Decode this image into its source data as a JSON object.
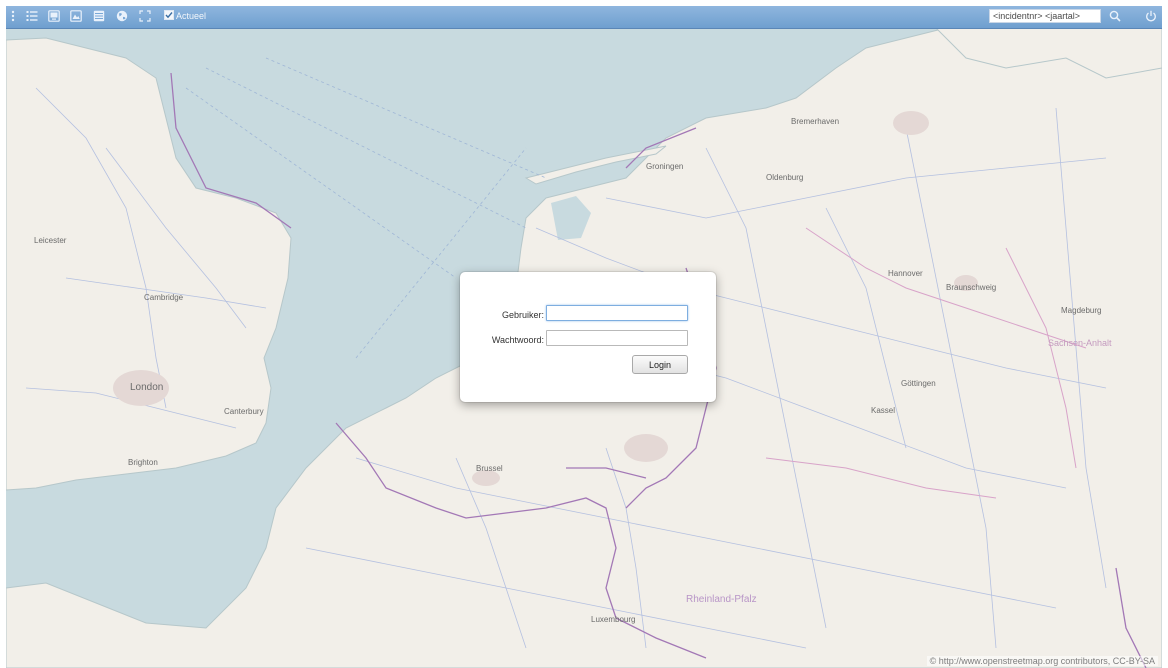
{
  "toolbar": {
    "buttons": [
      {
        "name": "menu-icon"
      },
      {
        "name": "layers-list-icon"
      },
      {
        "name": "monitor-icon"
      },
      {
        "name": "image-icon"
      },
      {
        "name": "table-icon"
      },
      {
        "name": "globe-icon"
      },
      {
        "name": "fullscreen-icon"
      }
    ],
    "actueel_label": "Actueel",
    "actueel_checked": true,
    "search_value": "<incidentnr> <jaartal>",
    "search_icon": "search-icon",
    "power_icon": "power-icon",
    "colors": {
      "bar": "#7aa8d6",
      "icon": "#e9f1fb"
    }
  },
  "map": {
    "colors": {
      "sea": "#c8dadf",
      "land": "#f2efe9",
      "border": "#a378b6",
      "road": "#b4c0e0"
    },
    "cities": [
      {
        "name": "London"
      },
      {
        "name": "Cambridge"
      },
      {
        "name": "Leicester"
      },
      {
        "name": "Brussel"
      },
      {
        "name": "Luxembourg"
      },
      {
        "name": "Bremerhaven"
      },
      {
        "name": "Oldenburg"
      },
      {
        "name": "Hannover"
      },
      {
        "name": "Braunschweig"
      },
      {
        "name": "Magdeburg"
      },
      {
        "name": "Göttingen"
      },
      {
        "name": "Kassel"
      },
      {
        "name": "Rheinland-Pfalz"
      },
      {
        "name": "Groningen"
      },
      {
        "name": "Sachsen-Anhalt"
      },
      {
        "name": "Canterbury"
      },
      {
        "name": "Brighton"
      }
    ],
    "attribution": "© http://www.openstreetmap.org contributors, CC-BY-SA"
  },
  "login": {
    "user_label": "Gebruiker:",
    "password_label": "Wachtwoord:",
    "user_value": "",
    "password_value": "",
    "button_label": "Login"
  }
}
